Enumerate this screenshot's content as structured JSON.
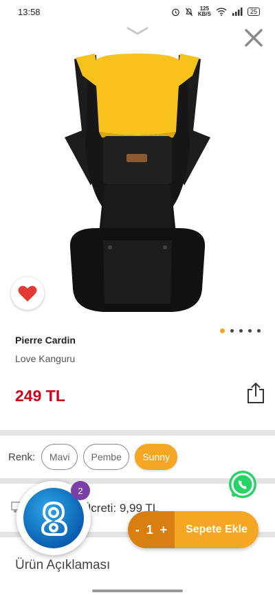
{
  "status_bar": {
    "time": "13:58",
    "net_speed_value": "125",
    "net_speed_unit": "KB/S",
    "battery": "25"
  },
  "product": {
    "brand": "Pierre Cardin",
    "name": "Love Kanguru",
    "price": "249 TL",
    "image_count": 5,
    "active_image_index": 0
  },
  "color_selector": {
    "label": "Renk:",
    "options": [
      "Mavi",
      "Pembe",
      "Sunny"
    ],
    "selected": "Sunny"
  },
  "shipping": {
    "text": "Ücreti:  9,99 TL"
  },
  "cart": {
    "minus": "-",
    "quantity": "1",
    "plus": "+",
    "add_label": "Sepete Ekle"
  },
  "assistant": {
    "badge_count": "2"
  },
  "description": {
    "title": "Ürün Açıklaması"
  },
  "colors": {
    "accent": "#f5a623",
    "accent_dark": "#d97f12",
    "price": "#d0021b",
    "heart": "#e53935",
    "whatsapp": "#25d366",
    "badge": "#7b3fa8"
  },
  "icons": [
    "chevron-down-icon",
    "close-icon",
    "heart-icon",
    "share-icon",
    "truck-icon",
    "whatsapp-icon",
    "assistant-icon"
  ]
}
